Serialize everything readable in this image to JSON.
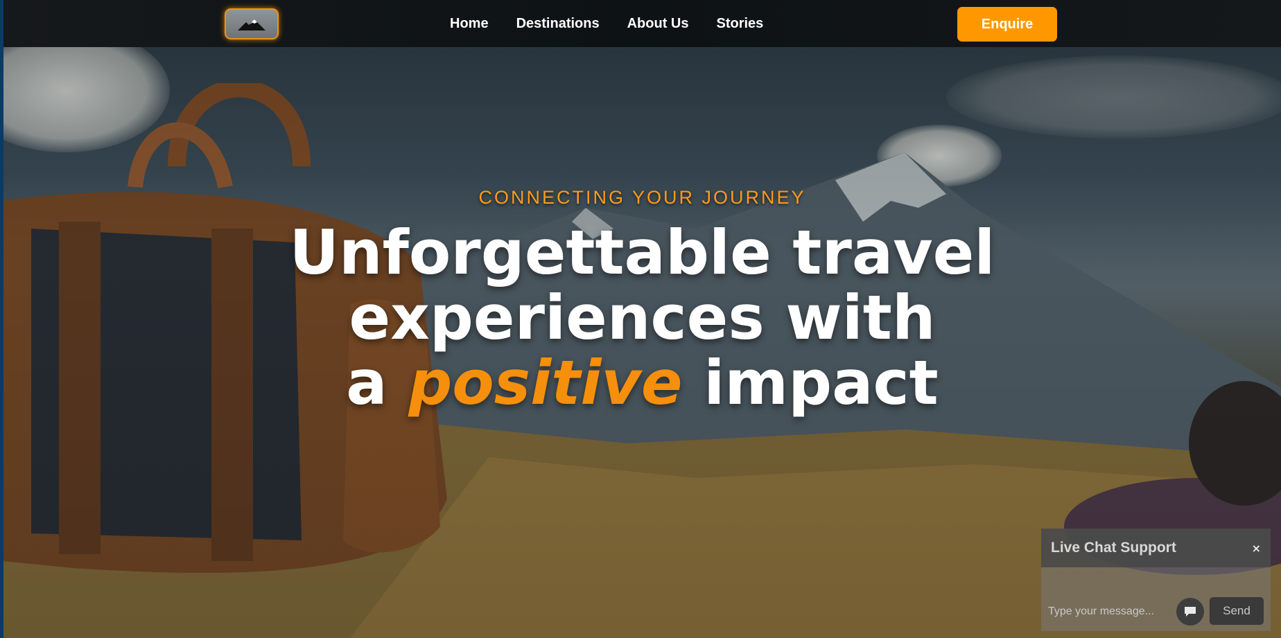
{
  "nav": {
    "items": [
      {
        "label": "Home"
      },
      {
        "label": "Destinations"
      },
      {
        "label": "About Us"
      },
      {
        "label": "Stories"
      }
    ],
    "enquire_label": "Enquire"
  },
  "hero": {
    "tagline": "CONNECTING YOUR JOURNEY",
    "line1": "Unforgettable travel",
    "line2": "experiences with",
    "line3_prefix": "a",
    "line3_accent": "positive",
    "line3_suffix": "impact"
  },
  "chat": {
    "title": "Live Chat Support",
    "close_glyph": "×",
    "placeholder": "Type your message...",
    "send_label": "Send"
  },
  "icons": {
    "logo": "mountain-logo-icon",
    "chat": "chat-bubble-icon"
  },
  "colors": {
    "accent": "#ff9800",
    "headline_accent": "#f58f0c"
  }
}
